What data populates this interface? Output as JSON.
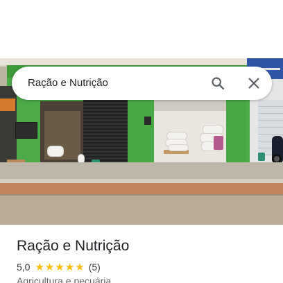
{
  "search": {
    "query": "Ração e Nutrição"
  },
  "place": {
    "name": "Ração e Nutrição",
    "rating": "5,0",
    "stars": 5,
    "review_count": "(5)",
    "category": "Agricultura e pecuária"
  },
  "icons": {
    "search": "search-icon",
    "close": "close-icon",
    "star": "star-icon"
  },
  "colors": {
    "star": "#fbbc04",
    "facade_green": "#4cab48",
    "text_primary": "#202124",
    "text_secondary": "#5f6368"
  }
}
